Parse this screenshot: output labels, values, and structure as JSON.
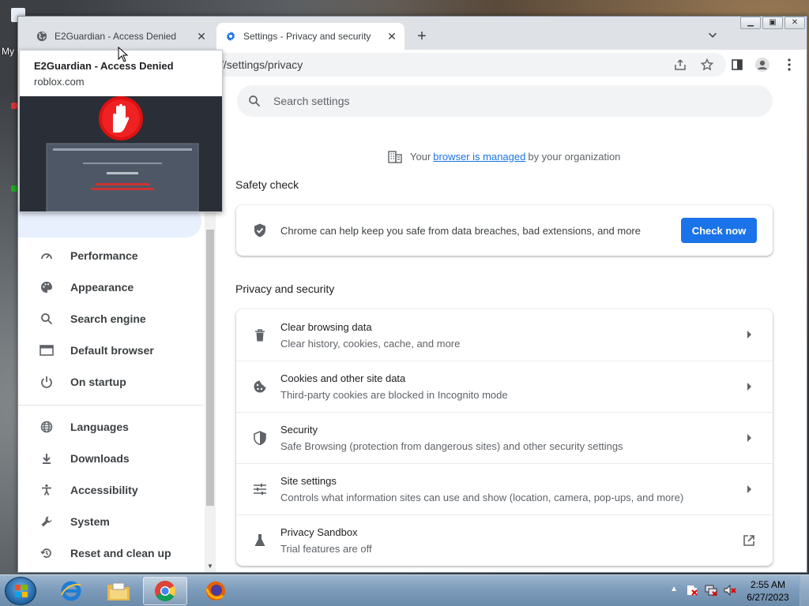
{
  "desktop": {
    "label": "My"
  },
  "browser": {
    "tabs": [
      {
        "title": "E2Guardian - Access Denied",
        "icon": "globe-icon"
      },
      {
        "title": "Settings - Privacy and security",
        "icon": "gear-icon"
      }
    ],
    "url": "//settings/privacy"
  },
  "tooltip": {
    "title": "E2Guardian - Access Denied",
    "url": "roblox.com"
  },
  "search": {
    "placeholder": "Search settings"
  },
  "managed": {
    "prefix": "Your",
    "link": "browser is managed",
    "suffix": "by your organization"
  },
  "sidebar": {
    "items": [
      {
        "label": "Performance",
        "icon": "speedometer-icon"
      },
      {
        "label": "Appearance",
        "icon": "palette-icon"
      },
      {
        "label": "Search engine",
        "icon": "search-icon"
      },
      {
        "label": "Default browser",
        "icon": "browser-icon"
      },
      {
        "label": "On startup",
        "icon": "power-icon"
      },
      {
        "label": "Languages",
        "icon": "globe-icon"
      },
      {
        "label": "Downloads",
        "icon": "download-icon"
      },
      {
        "label": "Accessibility",
        "icon": "accessibility-icon"
      },
      {
        "label": "System",
        "icon": "wrench-icon"
      },
      {
        "label": "Reset and clean up",
        "icon": "history-icon"
      }
    ]
  },
  "safety": {
    "title": "Safety check",
    "text": "Chrome can help keep you safe from data breaches, bad extensions, and more",
    "button": "Check now"
  },
  "privacy": {
    "title": "Privacy and security",
    "rows": [
      {
        "title": "Clear browsing data",
        "subtitle": "Clear history, cookies, cache, and more",
        "icon": "trash-icon"
      },
      {
        "title": "Cookies and other site data",
        "subtitle": "Third-party cookies are blocked in Incognito mode",
        "icon": "cookie-icon"
      },
      {
        "title": "Security",
        "subtitle": "Safe Browsing (protection from dangerous sites) and other security settings",
        "icon": "shield-icon"
      },
      {
        "title": "Site settings",
        "subtitle": "Controls what information sites can use and show (location, camera, pop-ups, and more)",
        "icon": "sliders-icon"
      },
      {
        "title": "Privacy Sandbox",
        "subtitle": "Trial features are off",
        "icon": "flask-icon"
      }
    ]
  },
  "taskbar": {
    "time": "2:55 AM",
    "date": "6/27/2023"
  }
}
